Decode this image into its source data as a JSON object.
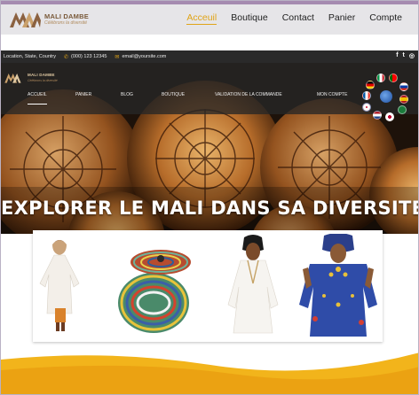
{
  "header": {
    "brand": "MALI DAMBE",
    "tagline": "Célébrons la diversité",
    "nav": [
      {
        "label": "Acceuil",
        "active": true
      },
      {
        "label": "Boutique",
        "active": false
      },
      {
        "label": "Contact",
        "active": false
      },
      {
        "label": "Panier",
        "active": false
      },
      {
        "label": "Compte",
        "active": false
      }
    ]
  },
  "info_bar": {
    "location": "Location, State, Country",
    "phone": "(000) 123 12345",
    "email": "email@yoursite.com",
    "socials": [
      "f",
      "t",
      "ig"
    ]
  },
  "hero": {
    "brand": "MALI DAMBE",
    "tagline": "Célébrons la diversité",
    "menu": [
      "ACCUEIL",
      "PANIER",
      "BLOG",
      "BOUTIQUE",
      "VALIDATION DE LA COMMANDE",
      "MON COMPTE"
    ],
    "title": "EXPLORER LE MALI DANS SA DIVERSITE",
    "languages": [
      "de",
      "it",
      "pt",
      "ru",
      "fr",
      "es",
      "en",
      "nl",
      "ja",
      "ar"
    ]
  },
  "colors": {
    "accent": "#e0a417",
    "header_bg": "#e6e5e8",
    "info_bar_bg": "#2a2a2a",
    "wave": "#f2b41b"
  },
  "products": [
    {
      "name": "woman-white-dress"
    },
    {
      "name": "woven-basket"
    },
    {
      "name": "woman-white-boubou"
    },
    {
      "name": "woman-blue-boubou"
    }
  ]
}
